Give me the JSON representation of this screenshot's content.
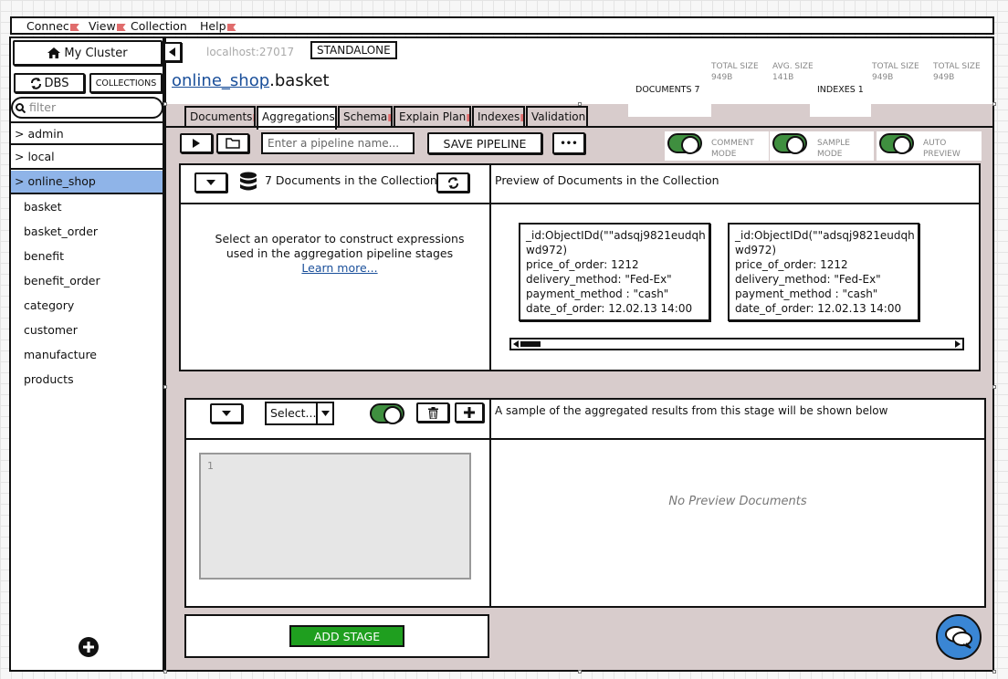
{
  "menu": [
    "Connec",
    "View",
    "Collection",
    "Help"
  ],
  "sidebar": {
    "cluster": "My Cluster",
    "dbs_button": "DBS",
    "collections_button": "COLLECTIONS",
    "filter_placeholder": "filter",
    "databases": [
      "> admin",
      "> local",
      "> online_shop"
    ],
    "collections": [
      "basket",
      "basket_order",
      "benefit",
      "benefit_order",
      "category",
      "customer",
      "manufacture",
      "products"
    ]
  },
  "header": {
    "host": "localhost:27017",
    "mode": "STANDALONE",
    "db_link": "online_shop",
    "collection": ".basket",
    "documents_label": "DOCUMENTS 7",
    "total_size_label": "TOTAL SIZE",
    "total_size_value": "949B",
    "avg_size_label": "AVG. SIZE",
    "avg_size_value": "141B",
    "indexes_label": "INDEXES 1",
    "idx_total_size_label": "TOTAL SIZE",
    "idx_total_size_value": "949B",
    "idx_total_size2_label": "TOTAL SIZE",
    "idx_total_size2_value": "949B"
  },
  "tabs": [
    "Documents",
    "Aggregations",
    "Schema",
    "Explain Plan",
    "Indexes",
    "Validation"
  ],
  "toolbar": {
    "pipeline_placeholder": "Enter a pipeline name...",
    "save_pipeline": "SAVE PIPELINE",
    "more": "•••",
    "comment_mode": "COMMENT MODE",
    "sample_mode": "SAMPLE MODE",
    "auto_preview": "AUTO PREVIEW"
  },
  "source_panel": {
    "doc_count": "7 Documents in the Collection",
    "preview_title": "Preview  of Documents in the Collection",
    "hint": "Select an operator to construct expressions used in the aggregation pipeline stages",
    "learn_more": "Learn more...",
    "docs": [
      {
        "id": "_id:ObjectIDd(\"\"adsqj9821eudqh wd972)",
        "price": "price_of_order: 1212",
        "delivery": "delivery_method: \"Fed-Ex\"",
        "payment": "payment_method : \"cash\"",
        "date": "date_of_order: 12.02.13 14:00"
      },
      {
        "id": "_id:ObjectIDd(\"\"adsqj9821eudqh wd972)",
        "price": "price_of_order: 1212",
        "delivery": "delivery_method: \"Fed-Ex\"",
        "payment": "payment_method : \"cash\"",
        "date": "date_of_order: 12.02.13 14:00"
      }
    ]
  },
  "stage": {
    "select": "Select...",
    "sample_text": "A sample of the aggregated results from this stage will be shown below",
    "line_number": "1",
    "no_preview": "No Preview Documents",
    "add_stage": "ADD STAGE"
  },
  "colors": {
    "toggle_green": "#3f8f3f",
    "add_stage_green": "#1f9f1f",
    "selected_db": "#8fb4e8",
    "panel_gray": "#d8cccc",
    "link_blue": "#1a4f9a",
    "chat_blue": "#3a86d4"
  }
}
